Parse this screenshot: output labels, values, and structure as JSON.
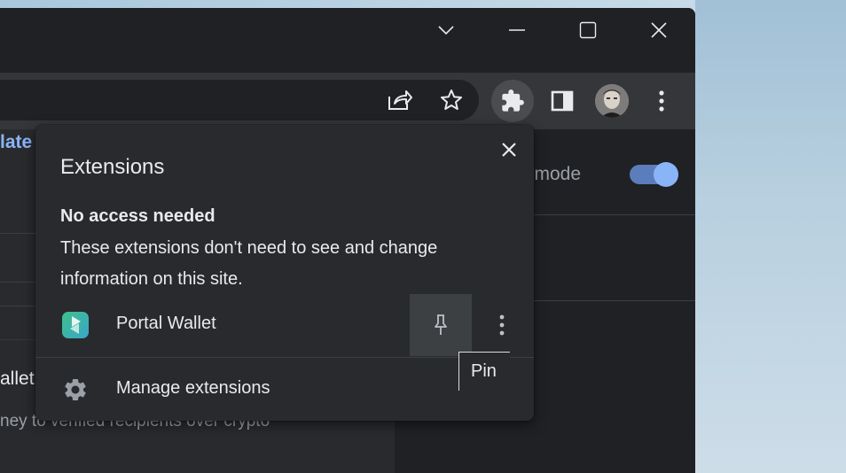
{
  "colors": {
    "accent": "#8ab4f8",
    "window_bg": "#202124",
    "toolbar_bg": "#35363a",
    "popup_bg": "#292a2d"
  },
  "window_controls": {
    "tab_search_icon": "chevron-down-icon",
    "minimize_icon": "minimize-icon",
    "maximize_icon": "maximize-icon",
    "close_icon": "close-icon"
  },
  "toolbar": {
    "icons": [
      "share-icon",
      "star-icon",
      "puzzle-icon",
      "side-panel-icon",
      "avatar",
      "kebab-menu-icon"
    ]
  },
  "page": {
    "developer_mode_fragment": "er mode",
    "developer_mode_on": true,
    "update_fragment": "late",
    "wallet_fragment": "allet",
    "subtitle_fragment": "ney to verified recipients over crypto"
  },
  "popup": {
    "title": "Extensions",
    "section_heading": "No access needed",
    "section_description": "These extensions don't need to see and change information on this site.",
    "extensions": [
      {
        "name": "Portal Wallet",
        "icon": "portal-wallet-icon",
        "pinned": false
      }
    ],
    "manage_label": "Manage extensions",
    "pin_tooltip": "Pin"
  }
}
